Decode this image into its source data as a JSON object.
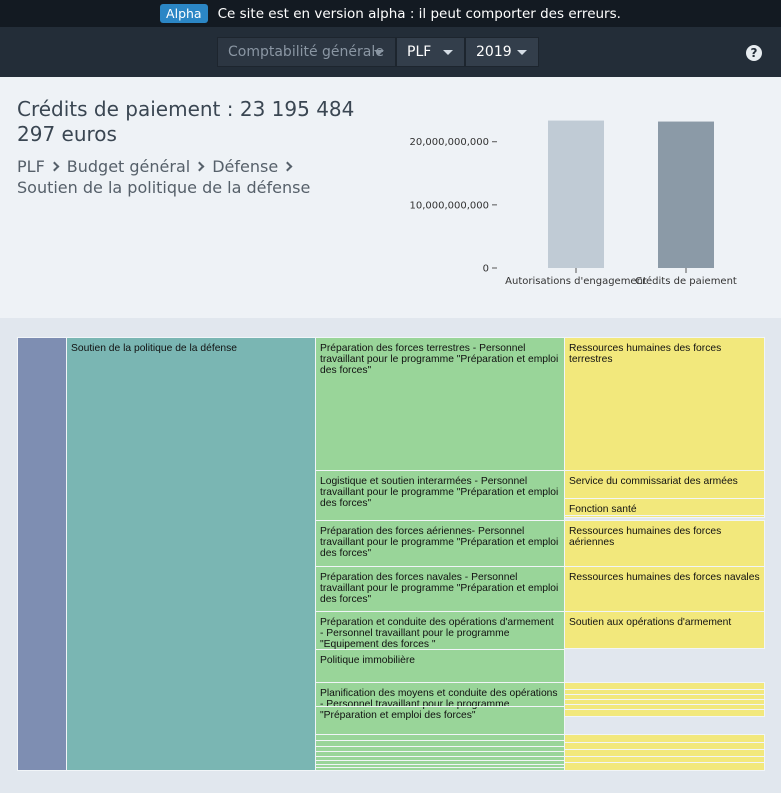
{
  "banner": {
    "badge": "Alpha",
    "message": "Ce site est en version alpha : il peut comporter des erreurs."
  },
  "nav": {
    "selectors": [
      {
        "name": "accounting",
        "value": "Comptabilité générale",
        "disabled": true
      },
      {
        "name": "plf",
        "value": "PLF",
        "disabled": false
      },
      {
        "name": "year",
        "value": "2019",
        "disabled": false
      }
    ],
    "help_label": "?"
  },
  "summary": {
    "title": "Crédits de paiement : 23 195 484 297 euros",
    "breadcrumb": [
      "PLF",
      "Budget général",
      "Défense",
      "Soutien de la politique de la défense"
    ]
  },
  "chart_data": {
    "type": "bar",
    "categories": [
      "Autorisations d'engagement",
      "Crédits de paiement"
    ],
    "values": [
      23352000000,
      23195484297
    ],
    "yticks": [
      0,
      10000000000,
      20000000000
    ],
    "ytick_labels": [
      "0",
      "10,000,000,000",
      "20,000,000,000"
    ],
    "ylim": [
      0,
      23600000000
    ],
    "colors": [
      "#c0cbd5",
      "#8b9aa7"
    ]
  },
  "treemap": {
    "root": {
      "label": ""
    },
    "program": {
      "label": "Soutien de la politique de la défense"
    },
    "actions": [
      {
        "label": "Préparation des forces terrestres - Personnel travaillant pour le programme \"Préparation et emploi des forces\""
      },
      {
        "label": "Logistique et soutien interarmées - Personnel travaillant pour le programme \"Préparation et emploi des forces\""
      },
      {
        "label": "Préparation des forces aériennes- Personnel travaillant pour le programme \"Préparation et emploi des forces\""
      },
      {
        "label": "Préparation des forces navales - Personnel travaillant pour le programme \"Préparation et emploi des forces\""
      },
      {
        "label": "Préparation et conduite des opérations d'armement - Personnel travaillant pour le programme \"Equipement des forces \""
      },
      {
        "label": "Politique immobilière"
      },
      {
        "label": "Planification des moyens et conduite des opérations - Personnel travaillant pour le programme \"Préparation et emploi des forces\""
      }
    ],
    "subs": [
      {
        "label": "Ressources humaines des forces terrestres"
      },
      {
        "label": "Service du commissariat des armées"
      },
      {
        "label": "Fonction santé"
      },
      {
        "label": "Ressources humaines des forces aériennes"
      },
      {
        "label": "Ressources humaines des forces navales"
      },
      {
        "label": "Soutien aux opérations d'armement"
      }
    ]
  }
}
